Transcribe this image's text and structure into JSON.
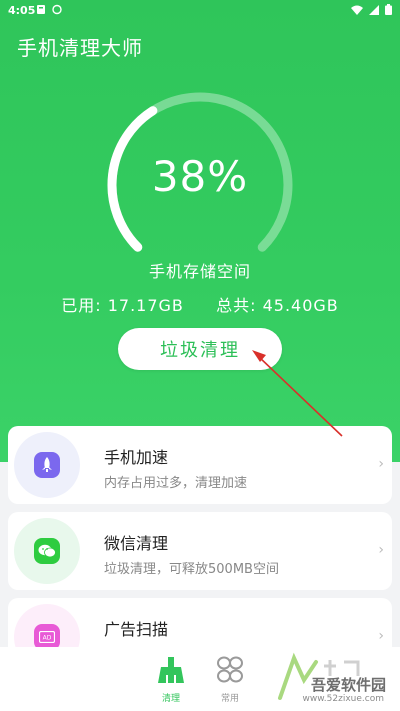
{
  "status_bar": {
    "time": "4:05"
  },
  "header": {
    "title": "手机清理大师"
  },
  "storage": {
    "percent_text": "38%",
    "percent_value": 0.38,
    "label": "手机存储空间",
    "used_label": "已用:",
    "used_value": "17.17GB",
    "total_label": "总共:",
    "total_value": "45.40GB"
  },
  "clean_button": {
    "label": "垃圾清理"
  },
  "cards": [
    {
      "title": "手机加速",
      "subtitle": "内存占用过多，清理加速",
      "icon": "rocket-icon",
      "icon_bg": "#eef0fb",
      "icon_color": "#7b68ee"
    },
    {
      "title": "微信清理",
      "subtitle": "垃圾清理，可释放500MB空间",
      "icon": "wechat-icon",
      "icon_bg": "#e8f8ec",
      "icon_color": "#2ecc40"
    },
    {
      "title": "广告扫描",
      "subtitle": "",
      "icon": "ad-icon",
      "icon_bg": "#fdeefa",
      "icon_color": "#e85ad6"
    }
  ],
  "tabs": [
    {
      "label": "清理",
      "icon": "broom-icon",
      "active": true
    },
    {
      "label": "常用",
      "icon": "grid-icon",
      "active": false
    }
  ],
  "watermark": {
    "title": "吾爱软件园",
    "url": "www.52zixue.com"
  },
  "colors": {
    "primary_green": "#34cc60",
    "clean_text": "#2cbf57",
    "arrow_red": "#d9302a"
  }
}
